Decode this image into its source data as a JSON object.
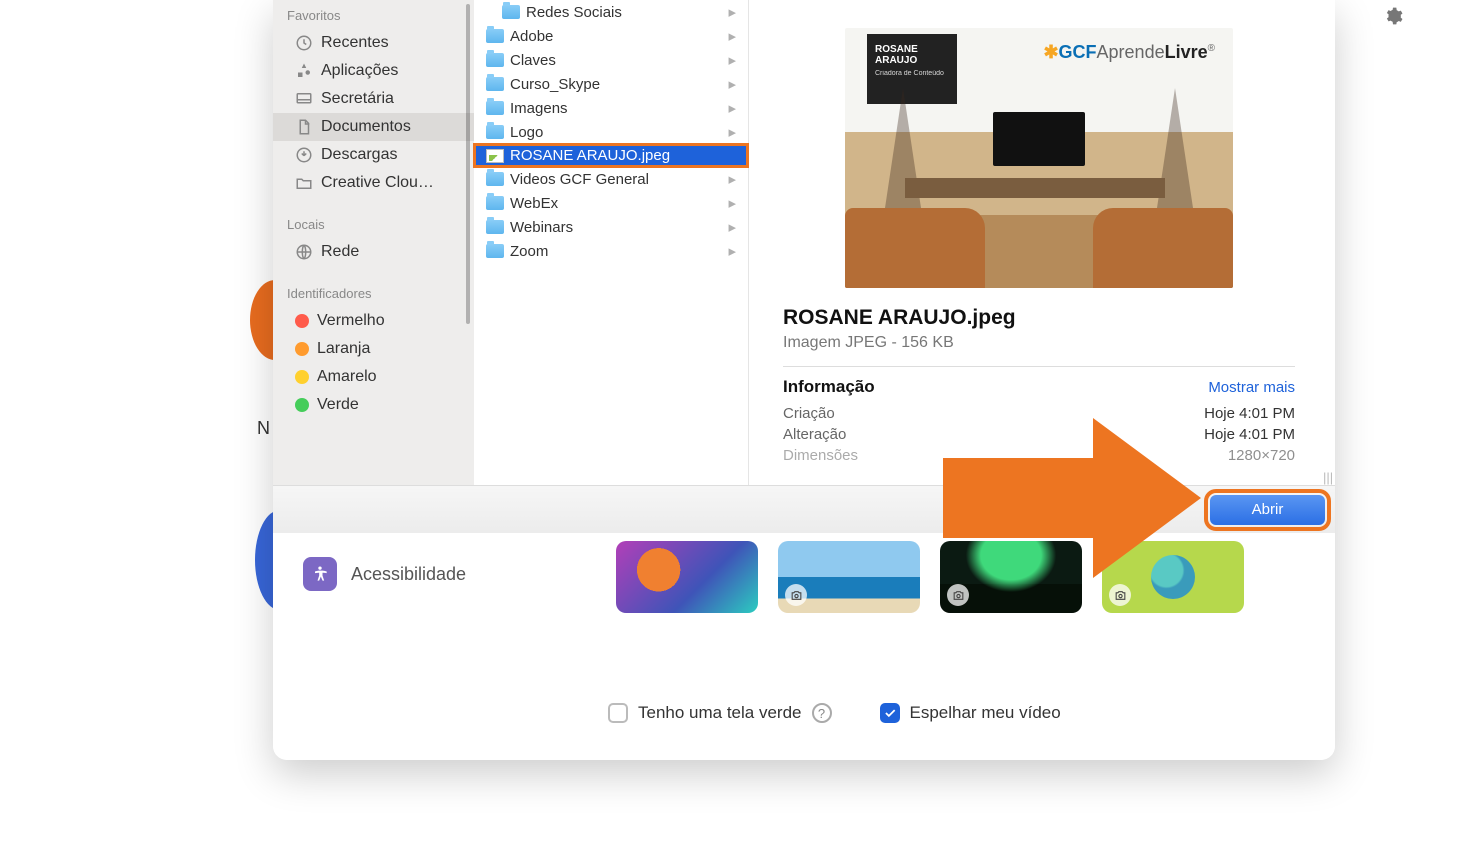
{
  "sidebar": {
    "sections": {
      "favorites_title": "Favoritos",
      "locations_title": "Locais",
      "tags_title": "Identificadores"
    },
    "favorites": [
      {
        "label": "Recentes",
        "icon": "clock"
      },
      {
        "label": "Aplicações",
        "icon": "apps"
      },
      {
        "label": "Secretária",
        "icon": "desktop"
      },
      {
        "label": "Documentos",
        "icon": "doc",
        "selected": true
      },
      {
        "label": "Descargas",
        "icon": "download"
      },
      {
        "label": "Creative Clou…",
        "icon": "folder"
      }
    ],
    "locations": [
      {
        "label": "Rede",
        "icon": "network"
      }
    ],
    "tags": [
      {
        "label": "Vermelho",
        "color": "#ff5b4b"
      },
      {
        "label": "Laranja",
        "color": "#ff9b2e"
      },
      {
        "label": "Amarelo",
        "color": "#ffd02e"
      },
      {
        "label": "Verde",
        "color": "#45cd5a"
      }
    ]
  },
  "files": [
    {
      "name": "Redes Sociais",
      "type": "folder"
    },
    {
      "name": "Adobe",
      "type": "folder"
    },
    {
      "name": "Claves",
      "type": "folder"
    },
    {
      "name": "Curso_Skype",
      "type": "folder"
    },
    {
      "name": "Imagens",
      "type": "folder"
    },
    {
      "name": "Logo",
      "type": "folder"
    },
    {
      "name": "ROSANE ARAUJO.jpeg",
      "type": "image",
      "selected": true,
      "highlighted": true
    },
    {
      "name": "Videos GCF General",
      "type": "folder"
    },
    {
      "name": "WebEx",
      "type": "folder"
    },
    {
      "name": "Webinars",
      "type": "folder"
    },
    {
      "name": "Zoom",
      "type": "folder"
    }
  ],
  "preview": {
    "badge_name": "ROSANE ARAUJO",
    "badge_sub": "Criadora de Conteúdo",
    "logo_prefix": "GCF",
    "logo_rest_a": "Aprende",
    "logo_rest_b": "Livre",
    "title": "ROSANE ARAUJO.jpeg",
    "subtitle": "Imagem JPEG - 156 KB",
    "info_label": "Informação",
    "more_label": "Mostrar mais",
    "rows": [
      {
        "label": "Criação",
        "value": "Hoje 4:01 PM"
      },
      {
        "label": "Alteração",
        "value": "Hoje 4:01 PM"
      },
      {
        "label": "Dimensões",
        "value": "1280×720"
      }
    ]
  },
  "actions": {
    "open_label": "Abrir"
  },
  "lower": {
    "accessibility_label": "Acessibilidade",
    "green_screen_label": "Tenho uma tela verde",
    "mirror_label": "Espelhar meu vídeo"
  },
  "side_n": "N"
}
